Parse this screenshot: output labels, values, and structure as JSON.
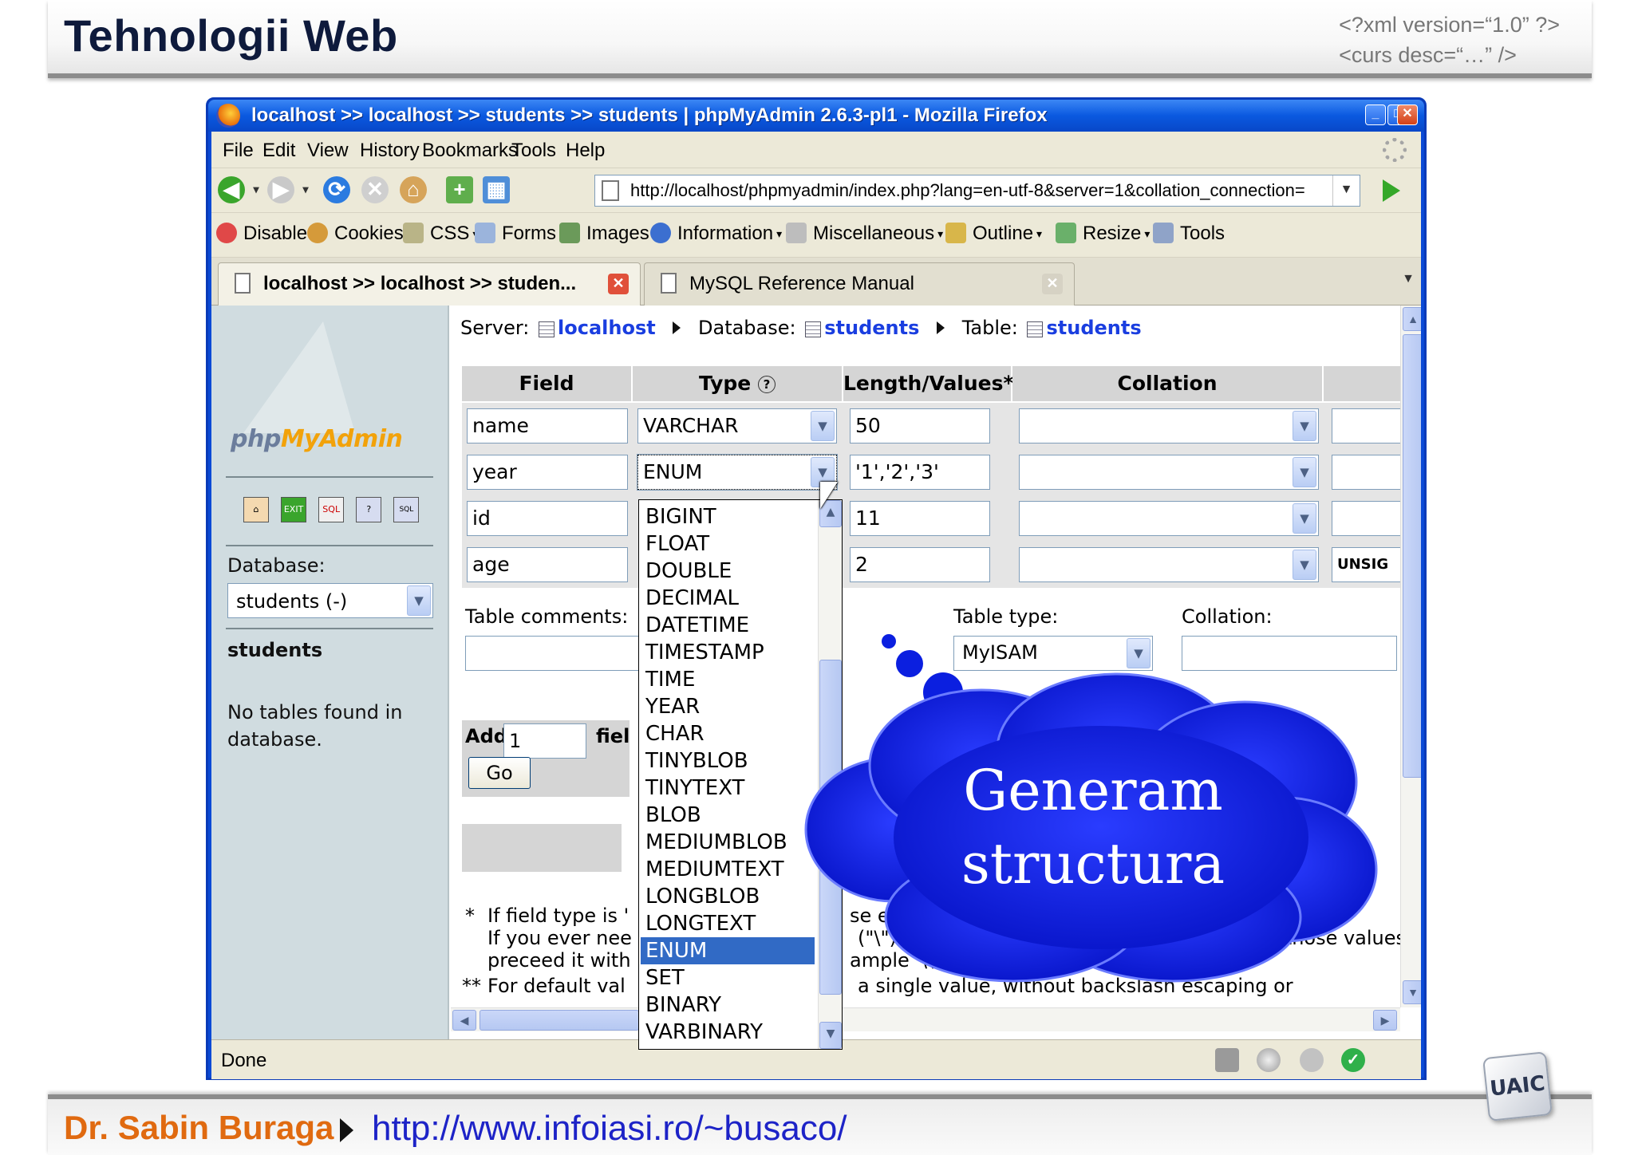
{
  "slide": {
    "title": "Tehnologii Web",
    "code_line1": "<?xml version=“1.0” ?>",
    "code_line2": "<curs desc=“…” />",
    "author": "Dr. Sabin Buraga",
    "url": "http://www.infoiasi.ro/~busaco/"
  },
  "window": {
    "title": "localhost >> localhost >> students  >> students | phpMyAdmin 2.6.3-pl1 - Mozilla Firefox"
  },
  "menu": [
    "File",
    "Edit",
    "View",
    "History",
    "Bookmarks",
    "Tools",
    "Help"
  ],
  "navbar": {
    "url": "http://localhost/phpmyadmin/index.php?lang=en-utf-8&server=1&collation_connection="
  },
  "devbar": [
    "Disable",
    "Cookies",
    "CSS",
    "Forms",
    "Images",
    "Information",
    "Miscellaneous",
    "Outline",
    "Resize",
    "Tools"
  ],
  "tabs": [
    {
      "label": "localhost >> localhost >> studen..."
    },
    {
      "label": "MySQL Reference Manual"
    }
  ],
  "left_frame": {
    "logo_php": "php",
    "logo_myadmin": "MyAdmin",
    "icons": [
      "home-icon",
      "exit-icon",
      "sql-icon",
      "help-icon",
      "sql-help-icon"
    ],
    "database_label": "Database:",
    "database_value": "students (-)",
    "db_name": "students",
    "no_tables_1": "No tables found in",
    "no_tables_2": "database."
  },
  "breadcrumb": {
    "server_label": "Server:",
    "server": "localhost",
    "database_label": "Database:",
    "database": "students",
    "table_label": "Table:",
    "table": "students"
  },
  "table": {
    "headers": [
      "Field",
      "Type",
      "Length/Values*",
      "Collation"
    ],
    "rows": [
      {
        "field": "name",
        "type": "VARCHAR",
        "length": "50",
        "extra": ""
      },
      {
        "field": "year",
        "type": "ENUM",
        "length": "'1','2','3'",
        "extra": ""
      },
      {
        "field": "id",
        "type": "",
        "length": "11",
        "extra": ""
      },
      {
        "field": "age",
        "type": "",
        "length": "2",
        "extra": "UNSIG"
      }
    ]
  },
  "lower": {
    "table_comments": "Table comments:",
    "table_type_label": "Table type:",
    "table_type_value": "MyISAM",
    "collation_label": "Collation:",
    "add_label": "Add",
    "add_value": "1",
    "fields_frag": "fiel",
    "go": "Go"
  },
  "footnotes": {
    "l1_a": "*",
    "l1_b": "If field type is '",
    "l1_c": "se en",
    "l1_d": "...",
    "l2_a": "If you ever nee",
    "l2_b": "(\"\\\") or a single quo",
    "l2_c": "gst those values,",
    "l3_a": "preceed it with",
    "l3_b": "ample '\\\\xyz' or 'a\\'b').",
    "l4_a": "**",
    "l4_b": "For default val",
    "l4_c": "a single value, without backslash escaping or"
  },
  "dropdown": {
    "options": [
      "BIGINT",
      "FLOAT",
      "DOUBLE",
      "DECIMAL",
      "DATETIME",
      "TIMESTAMP",
      "TIME",
      "YEAR",
      "CHAR",
      "TINYBLOB",
      "TINYTEXT",
      "BLOB",
      "MEDIUMBLOB",
      "MEDIUMTEXT",
      "LONGBLOB",
      "LONGTEXT",
      "ENUM",
      "SET",
      "BINARY",
      "VARBINARY"
    ],
    "selected": "ENUM"
  },
  "cloud": {
    "line1": "Generam",
    "line2": "structura",
    "color": "#0b1fe0"
  },
  "status": {
    "text": "Done"
  }
}
